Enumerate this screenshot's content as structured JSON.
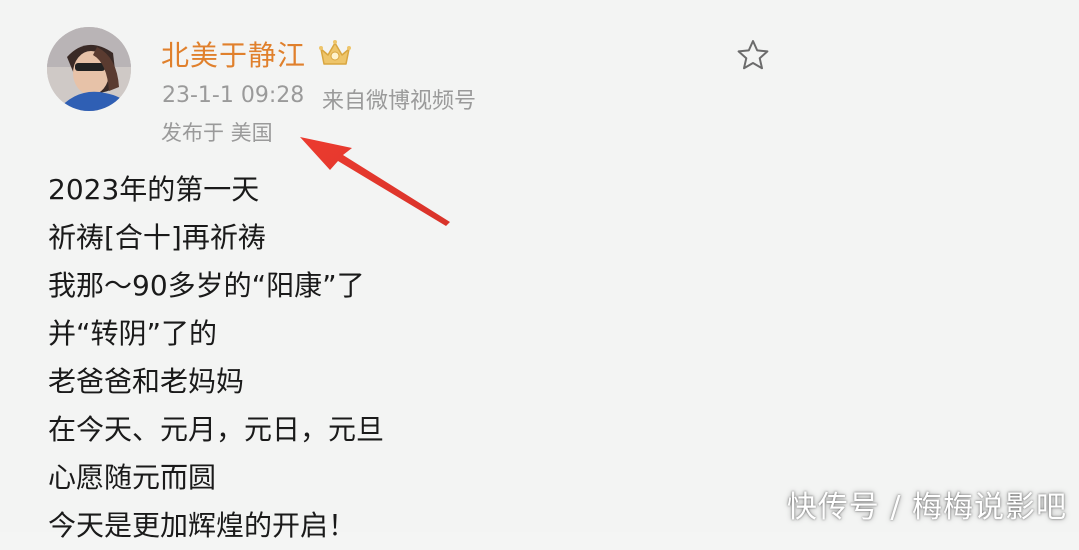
{
  "post": {
    "author": {
      "name": "北美于静江",
      "badge_icon": "crown-badge-icon"
    },
    "meta": {
      "time": "23-1-1 09:28",
      "source": "来自微博视频号",
      "location": "发布于 美国"
    },
    "favorite_icon": "star-icon",
    "body_lines": [
      "2023年的第一天",
      "祈祷[合十]再祈祷",
      "我那～90多岁的“阳康”了",
      "并“转阴”了的",
      "老爸爸和老妈妈",
      "在今天、元月，元日，元旦",
      "心愿随元而圆",
      "今天是更加辉煌的开启！"
    ]
  },
  "annotation": {
    "arrow_color": "#e0352b"
  },
  "watermark": {
    "text": "快传号 / 梅梅说影吧"
  },
  "colors": {
    "username": "#e0802c",
    "meta": "#9a9a9a",
    "body_text": "#1a1a1a",
    "background": "#f3f4f3"
  }
}
